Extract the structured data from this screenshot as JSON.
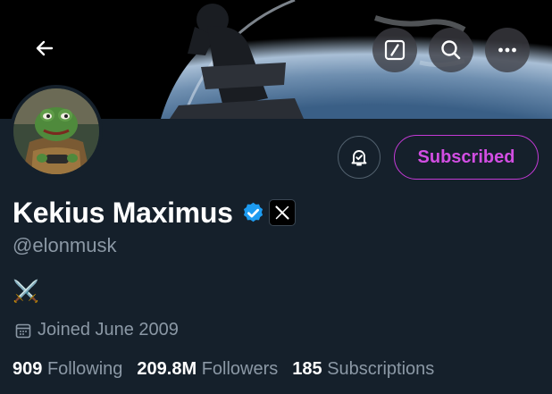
{
  "profile": {
    "display_name": "Kekius Maximus",
    "handle": "@elonmusk",
    "bio": "⚔️",
    "joined": "Joined June 2009",
    "subscribe_label": "Subscribed"
  },
  "stats": {
    "following_count": "909",
    "following_label": "Following",
    "followers_count": "209.8M",
    "followers_label": "Followers",
    "subscriptions_count": "185",
    "subscriptions_label": "Subscriptions"
  },
  "icons": {
    "back": "arrow-left-icon",
    "compose": "slash-box-icon",
    "search": "search-icon",
    "more": "more-horizontal-icon",
    "notify": "bell-check-icon",
    "verified": "verified-badge-icon",
    "affiliation": "x-logo-badge"
  },
  "colors": {
    "background": "#15202b",
    "accent": "#d24ee3",
    "verified": "#1d9bf0",
    "muted": "#8b98a5"
  }
}
